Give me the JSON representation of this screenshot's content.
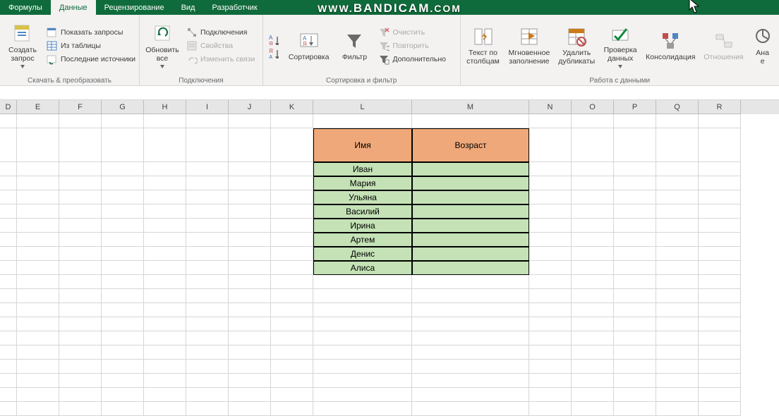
{
  "tabs": {
    "formulas": "Формулы",
    "data": "Данные",
    "review": "Рецензирование",
    "view": "Вид",
    "developer": "Разработчик"
  },
  "watermark": {
    "prefix": "WWW.",
    "brand": "BANDICAM",
    "suffix": ".COM"
  },
  "ribbon": {
    "group1": {
      "label": "Скачать & преобразовать",
      "create_query": "Создать\nзапрос",
      "show_queries": "Показать запросы",
      "from_table": "Из таблицы",
      "recent_sources": "Последние источники"
    },
    "group2": {
      "label": "Подключения",
      "refresh_all": "Обновить\nвсе",
      "connections": "Подключения",
      "properties": "Свойства",
      "edit_links": "Изменить связи"
    },
    "group3": {
      "label": "Сортировка и фильтр",
      "sort_az": "А↓Я",
      "sort_za": "Я↓А",
      "sort": "Сортировка",
      "filter": "Фильтр",
      "clear": "Очистить",
      "reapply": "Повторить",
      "advanced": "Дополнительно"
    },
    "group4": {
      "label": "Работа с данными",
      "text_cols": "Текст по\nстолбцам",
      "flash_fill": "Мгновенное\nзаполнение",
      "remove_dup": "Удалить\nдубликаты",
      "data_val": "Проверка\nданных",
      "consolidate": "Консолидация",
      "relations": "Отношения",
      "analysis_stub": "Ана\nе"
    }
  },
  "columns": [
    "D",
    "E",
    "F",
    "G",
    "H",
    "I",
    "J",
    "K",
    "L",
    "M",
    "N",
    "O",
    "P",
    "Q",
    "R"
  ],
  "table": {
    "headers": {
      "name": "Имя",
      "age": "Возраст"
    },
    "rows": [
      "Иван",
      "Мария",
      "Ульяна",
      "Василий",
      "Ирина",
      "Артем",
      "Денис",
      "Алиса"
    ]
  }
}
